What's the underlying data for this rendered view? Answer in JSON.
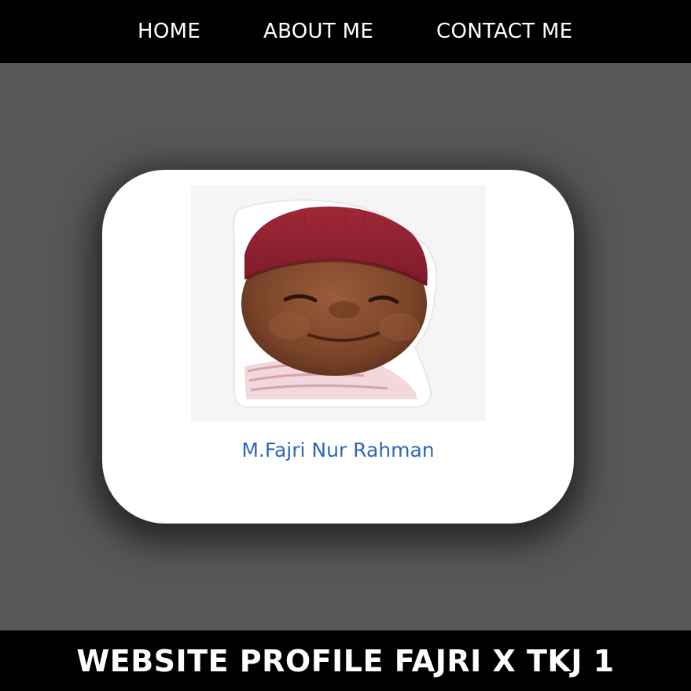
{
  "nav": {
    "items": [
      {
        "label": "HOME"
      },
      {
        "label": "ABOUT ME"
      },
      {
        "label": "CONTACT ME"
      }
    ]
  },
  "profile": {
    "name": "M.Fajri Nur Rahman",
    "photo_alt": "baby-in-red-beanie-sticker"
  },
  "footer": {
    "title": "WEBSITE PROFILE FAJRI X TKJ 1"
  },
  "colors": {
    "nav_bg": "#000000",
    "page_bg": "#575757",
    "card_bg": "#ffffff",
    "name_text": "#2f67b8",
    "footer_bg": "#000000",
    "nav_text": "#ffffff"
  }
}
